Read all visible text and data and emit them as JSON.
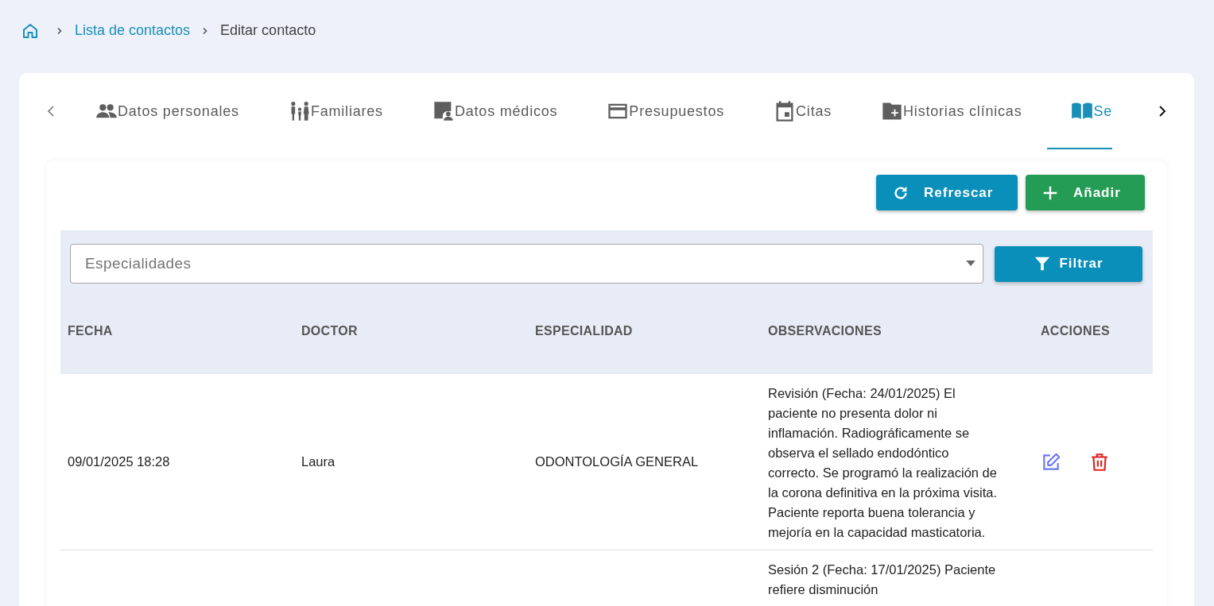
{
  "breadcrumb": {
    "items": [
      {
        "label": "Lista de contactos"
      },
      {
        "label": "Editar contacto"
      }
    ]
  },
  "tabs": [
    {
      "label": "Datos personales",
      "selected": false
    },
    {
      "label": "Familiares",
      "selected": false
    },
    {
      "label": "Datos médicos",
      "selected": false
    },
    {
      "label": "Presupuestos",
      "selected": false
    },
    {
      "label": "Citas",
      "selected": false
    },
    {
      "label": "Historias clínicas",
      "selected": false
    },
    {
      "label": "Se",
      "selected": true
    }
  ],
  "toolbar": {
    "buttons": [
      {
        "label": "Refrescar",
        "kind": "refresh"
      },
      {
        "label": "Añadir",
        "kind": "add"
      }
    ]
  },
  "filter": {
    "placeholder": "Especialidades",
    "button": "Filtrar"
  },
  "table": {
    "columns": [
      "FECHA",
      "DOCTOR",
      "ESPECIALIDAD",
      "OBSERVACIONES",
      "ACCIONES"
    ],
    "rows": [
      {
        "fecha": "09/01/2025 18:28",
        "doctor": "Laura",
        "especialidad": "ODONTOLOGÍA GENERAL",
        "observaciones": "Revisión (Fecha: 24/01/2025) El paciente no presenta dolor ni inflamación. Radiográficamente se observa el sellado endodóntico correcto. Se programó la realización de la corona definitiva en la próxima visita. Paciente reporta buena tolerancia y mejoría en la capacidad masticatoria."
      },
      {
        "observaciones": "Sesión 2 (Fecha: 17/01/2025) Paciente refiere disminución"
      }
    ]
  }
}
